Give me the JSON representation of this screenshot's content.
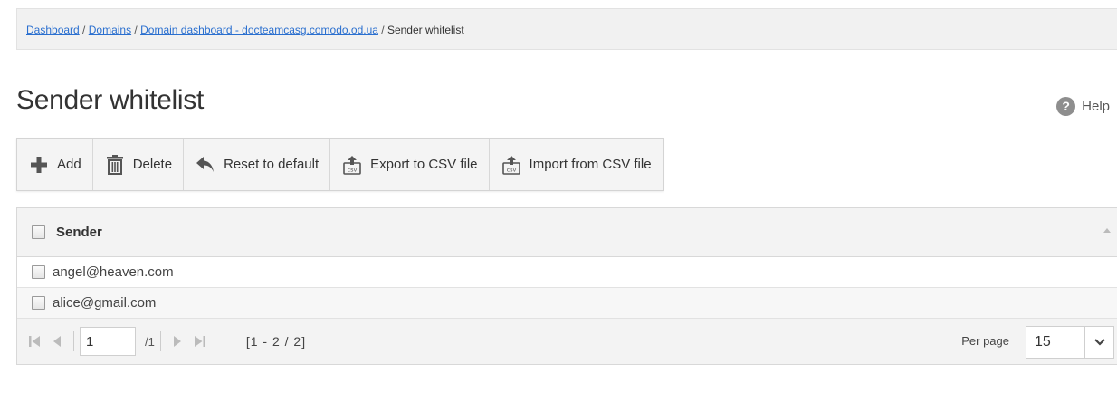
{
  "breadcrumb": {
    "items": [
      {
        "label": "Dashboard",
        "link": true
      },
      {
        "label": "Domains",
        "link": true
      },
      {
        "label": "Domain dashboard - docteamcasg.comodo.od.ua",
        "link": true
      },
      {
        "label": "Sender whitelist",
        "link": false
      }
    ],
    "separator": " / "
  },
  "page": {
    "title": "Sender whitelist",
    "help_label": "Help",
    "help_icon": "question-icon"
  },
  "toolbar": {
    "add_label": "Add",
    "delete_label": "Delete",
    "reset_label": "Reset to default",
    "export_label": "Export to CSV file",
    "import_label": "Import from CSV file"
  },
  "grid": {
    "column_header": "Sender",
    "rows": [
      {
        "sender": "angel@heaven.com"
      },
      {
        "sender": "alice@gmail.com"
      }
    ]
  },
  "pager": {
    "current_page": "1",
    "page_total": "/1",
    "range": "[1 - 2 / 2]",
    "per_page_label": "Per page",
    "per_page_value": "15"
  },
  "colors": {
    "link": "#2a6fcf",
    "add_icon": "#555555",
    "toolbar_bg": "#f4f4f4"
  }
}
